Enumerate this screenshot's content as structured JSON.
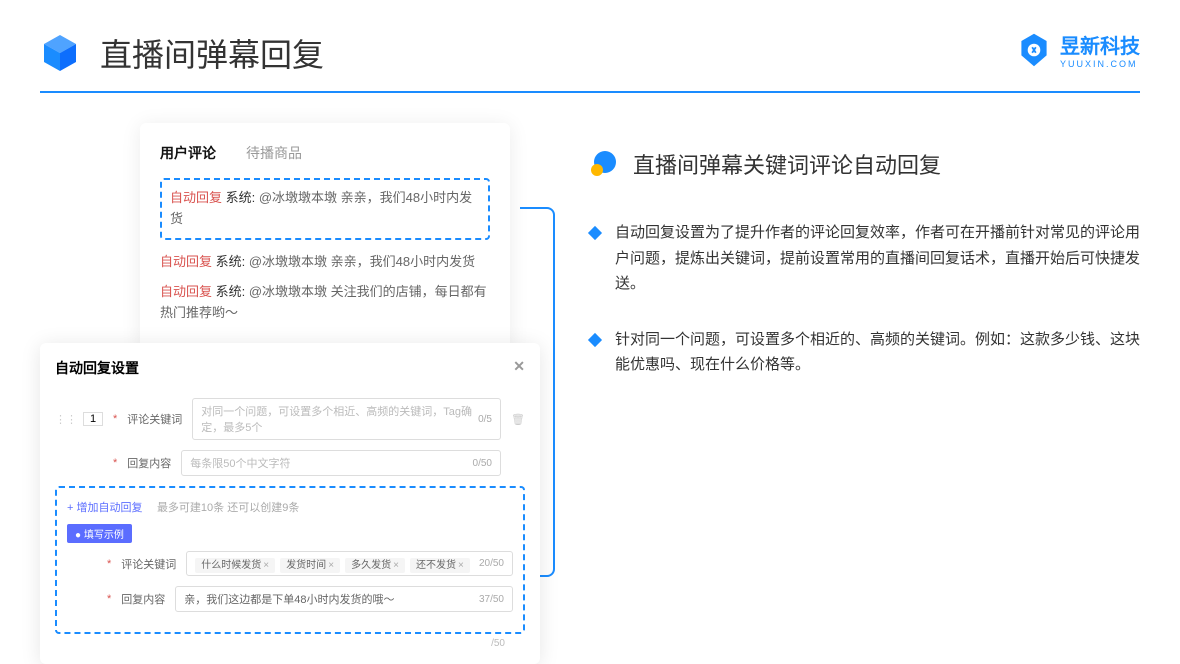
{
  "header": {
    "title": "直播间弹幕回复"
  },
  "brand": {
    "name": "昱新科技",
    "url": "YUUXIN.COM"
  },
  "card1": {
    "tab1": "用户评论",
    "tab2": "待播商品",
    "c1": {
      "tag": "自动回复",
      "sys": " 系统:",
      "text": " @冰墩墩本墩 亲亲，我们48小时内发货"
    },
    "c2": {
      "tag": "自动回复",
      "sys": " 系统:",
      "text": " @冰墩墩本墩 亲亲，我们48小时内发货"
    },
    "c3": {
      "tag": "自动回复",
      "sys": " 系统:",
      "text": " @冰墩墩本墩 关注我们的店铺，每日都有热门推荐哟～"
    }
  },
  "card2": {
    "title": "自动回复设置",
    "row_num": "1",
    "kw_label": "评论关键词",
    "kw_ph": "对同一个问题，可设置多个相近、高频的关键词，Tag确定，最多5个",
    "kw_ct": "0/5",
    "rp_label": "回复内容",
    "rp_ph": "每条限50个中文字符",
    "rp_ct": "0/50",
    "add": "+ 增加自动回复",
    "add_hint": "最多可建10条 还可以创建9条",
    "badge": "● 填写示例",
    "ex_kw_label": "评论关键词",
    "t1": "什么时候发货",
    "t2": "发货时间",
    "t3": "多久发货",
    "t4": "还不发货",
    "ex_kw_ct": "20/50",
    "ex_rp_label": "回复内容",
    "ex_rp": "亲，我们这边都是下单48小时内发货的哦～",
    "ex_rp_ct": "37/50",
    "stray_ct": "/50"
  },
  "right": {
    "title": "直播间弹幕关键词评论自动回复",
    "b1": "自动回复设置为了提升作者的评论回复效率，作者可在开播前针对常见的评论用户问题，提炼出关键词，提前设置常用的直播间回复话术，直播开始后可快捷发送。",
    "b2": "针对同一个问题，可设置多个相近的、高频的关键词。例如：这款多少钱、这块能优惠吗、现在什么价格等。"
  }
}
